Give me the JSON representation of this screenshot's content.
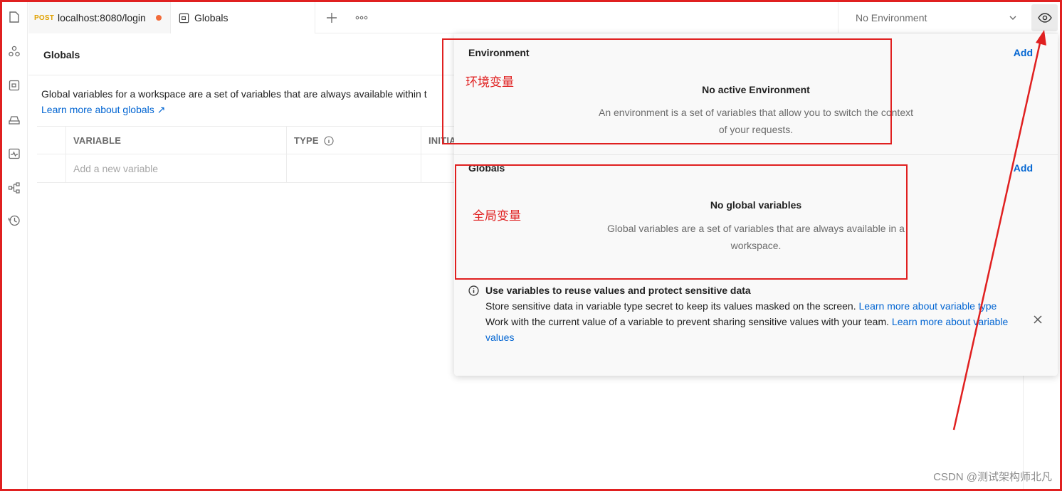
{
  "tabs": [
    {
      "method": "POST",
      "label": "localhost:8080/login"
    },
    {
      "label": "Globals"
    }
  ],
  "environment_selector": {
    "value": "No Environment"
  },
  "globals_page": {
    "title": "Globals",
    "description": "Global variables for a workspace are a set of variables that are always available within t",
    "learn_link": "Learn more about globals ↗",
    "columns": [
      "VARIABLE",
      "TYPE",
      "INITIA"
    ],
    "new_variable_placeholder": "Add a new variable"
  },
  "quick_look": {
    "environment": {
      "title": "Environment",
      "add_label": "Add",
      "empty_title": "No active Environment",
      "empty_desc": "An environment is a set of variables that allow you to switch the context of your requests."
    },
    "globals": {
      "title": "Globals",
      "add_label": "Add",
      "empty_title": "No global variables",
      "empty_desc": "Global variables are a set of variables that are always available in a workspace."
    },
    "tip": {
      "heading": "Use variables to reuse values and protect sensitive data",
      "line1": "Store sensitive data in variable type secret to keep its values masked on the screen.",
      "line1_link": "Learn more about variable type",
      "line2": "Work with the current value of a variable to prevent sharing sensitive values with your team.",
      "line2_link": "Learn more about variable values"
    }
  },
  "annotations": {
    "environment_label": "环境变量",
    "globals_label": "全局变量",
    "color": "#e02020"
  },
  "watermark": "CSDN @测试架构师北凡",
  "colors": {
    "link": "#0265d2",
    "method_post": "#e0a100",
    "unsaved_dot": "#f26b3a"
  }
}
